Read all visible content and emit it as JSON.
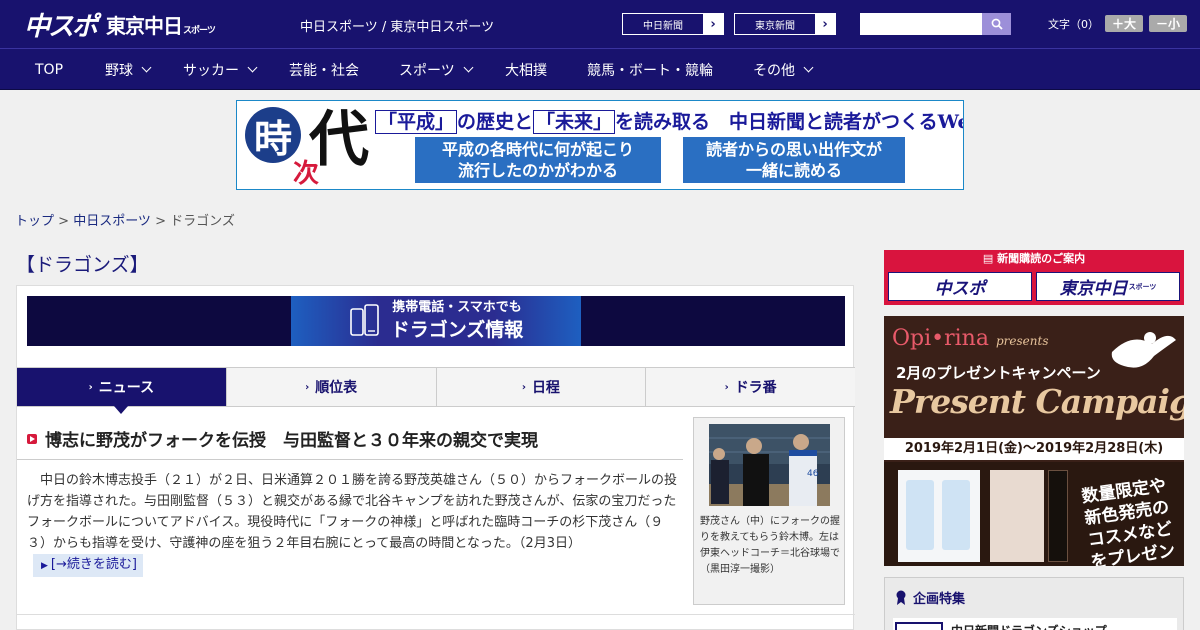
{
  "header": {
    "logo_main": "中スポ",
    "logo_tokyo": "東京中日",
    "logo_tokyo_suffix": "スポーツ",
    "site_link": "中日スポーツ / 東京中日スポーツ",
    "buttons": [
      {
        "label": "中日新聞",
        "arrow": "›"
      },
      {
        "label": "東京新聞",
        "arrow": "›"
      }
    ],
    "search_placeholder": "",
    "font_size_label": "文字（0）",
    "font_bigger": "＋大",
    "font_smaller": "－小"
  },
  "nav": [
    {
      "label": "TOP",
      "dropdown": false
    },
    {
      "label": "野球",
      "dropdown": true
    },
    {
      "label": "サッカー",
      "dropdown": true
    },
    {
      "label": "芸能・社会",
      "dropdown": false
    },
    {
      "label": "スポーツ",
      "dropdown": true
    },
    {
      "label": "大相撲",
      "dropdown": false
    },
    {
      "label": "競馬・ボート・競輪",
      "dropdown": false
    },
    {
      "label": "その他",
      "dropdown": true
    }
  ],
  "banner": {
    "kanji_1": "時",
    "kanji_2": "次",
    "kanji_3": "代",
    "headline_1": "「平成」",
    "headline_2": "の歴史と",
    "headline_3": "「未来」",
    "headline_4": "を読み取る　中日新聞と読者がつくるWebサイト",
    "box_left_line1": "平成の各時代に何が起こり",
    "box_left_line2": "流行したのかがわかる",
    "box_right_line1": "読者からの思い出作文が",
    "box_right_line2": "一緒に読める"
  },
  "breadcrumb": {
    "home": "トップ",
    "sep1": " > ",
    "section": "中日スポーツ",
    "sep2": " > ",
    "current": "ドラゴンズ"
  },
  "page_title": "【ドラゴンズ】",
  "mobile_banner": {
    "line1": "携帯電話・スマホでも",
    "line2": "ドラゴンズ情報"
  },
  "tabs": [
    {
      "label": "ニュース",
      "active": true
    },
    {
      "label": "順位表",
      "active": false
    },
    {
      "label": "日程",
      "active": false
    },
    {
      "label": "ドラ番",
      "active": false
    }
  ],
  "article": {
    "title": "博志に野茂がフォークを伝授　与田監督と３０年来の親交で実現",
    "body": "中日の鈴木博志投手（２１）が２日、日米通算２０１勝を誇る野茂英雄さん（５０）からフォークボールの投げ方を指導された。与田剛監督（５３）と親交がある縁で北谷キャンプを訪れた野茂さんが、伝家の宝刀だったフォークボールについてアドバイス。現役時代に「フォークの神様」と呼ばれた臨時コーチの杉下茂さん（９３）からも指導を受け、守護神の座を狙う２年目右腕にとって最高の時間となった。（2月3日）",
    "read_more": "[→続きを読む]",
    "caption": "野茂さん（中）にフォークの握りを教えてもらう鈴木博。左は伊東ヘッドコーチ＝北谷球場で（黒田淳一撮影）"
  },
  "sidebar": {
    "subscribe_header": "新聞購読のご案内",
    "sub_logo_1": "中スポ",
    "sub_logo_2": "東京中日",
    "sub_logo_2_suffix": "スポーツ",
    "ad_brand": "Opi•rina",
    "ad_presents": "presents",
    "ad_campaign": "2月のプレゼントキャンペーン",
    "ad_big": "Present Campaign",
    "ad_dates": "2019年2月1日(金)～2019年2月28日(木)",
    "ad_promo": "数量限定や新色発売のコスメなどをプレゼント!",
    "feature_title": "企画特集",
    "feature_item": "中日新聞ドラゴンズショップ"
  },
  "colors": {
    "brand_navy": "#18126e",
    "accent_red": "#d9143e",
    "banner_blue": "#2a6fc2"
  }
}
